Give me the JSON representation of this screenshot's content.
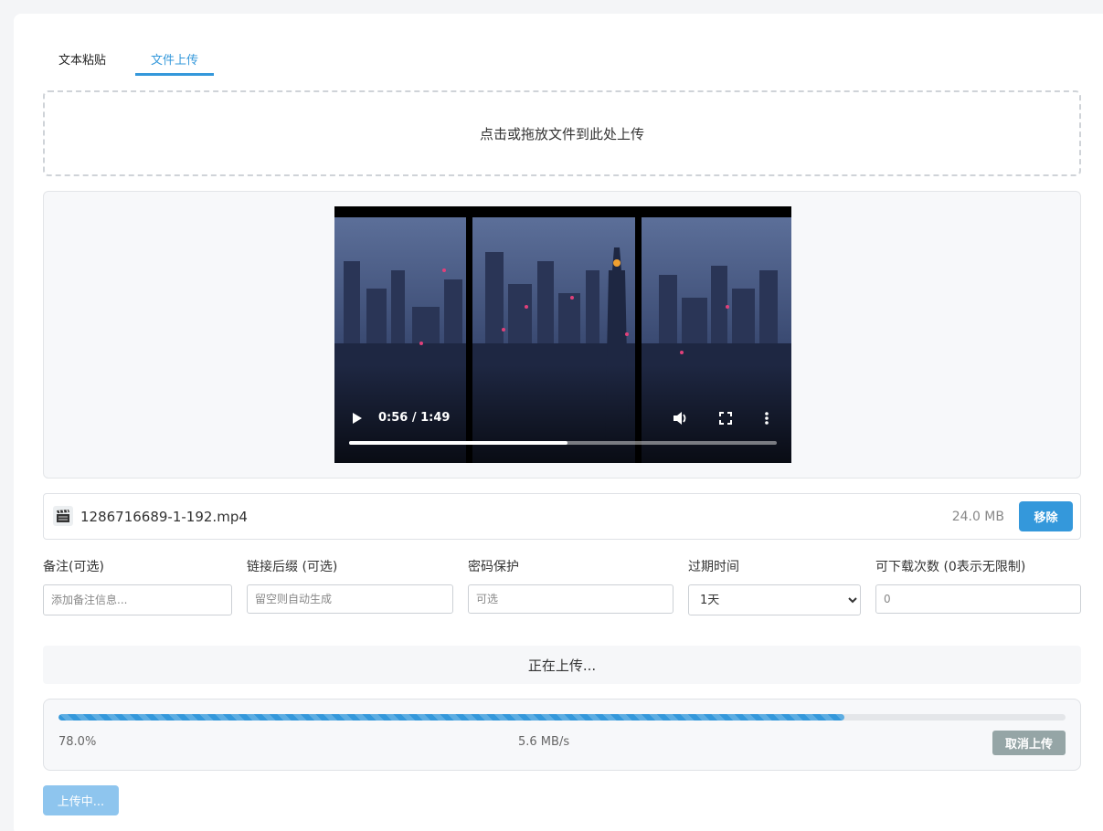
{
  "tabs": [
    {
      "label": "文本粘贴",
      "active": false
    },
    {
      "label": "文件上传",
      "active": true
    }
  ],
  "dropzone": {
    "text": "点击或拖放文件到此处上传"
  },
  "video": {
    "time": "0:56 / 1:49",
    "played_fraction": 0.51,
    "icons": [
      "play-icon",
      "volume-icon",
      "fullscreen-icon",
      "more-options-icon"
    ]
  },
  "file": {
    "icon": "clapper-board-icon",
    "name": "1286716689-1-192.mp4",
    "size": "24.0 MB",
    "remove_label": "移除"
  },
  "form": {
    "note": {
      "label": "备注(可选)",
      "placeholder": "添加备注信息..."
    },
    "suffix": {
      "label": "链接后缀 (可选)",
      "placeholder": "留空则自动生成"
    },
    "password": {
      "label": "密码保护",
      "placeholder": "可选"
    },
    "expiry": {
      "label": "过期时间",
      "selected": "1天"
    },
    "downloads": {
      "label": "可下载次数 (0表示无限制)",
      "placeholder": "0"
    }
  },
  "status": {
    "text": "正在上传..."
  },
  "upload": {
    "progress": 0.78,
    "percent_text": "78.0%",
    "speed_text": "5.6 MB/s",
    "cancel_label": "取消上传"
  },
  "submit": {
    "label": "上传中..."
  },
  "colors": {
    "accent": "#3498db",
    "cancel": "#95a5a6",
    "submit_disabled": "#8ec5ee"
  }
}
